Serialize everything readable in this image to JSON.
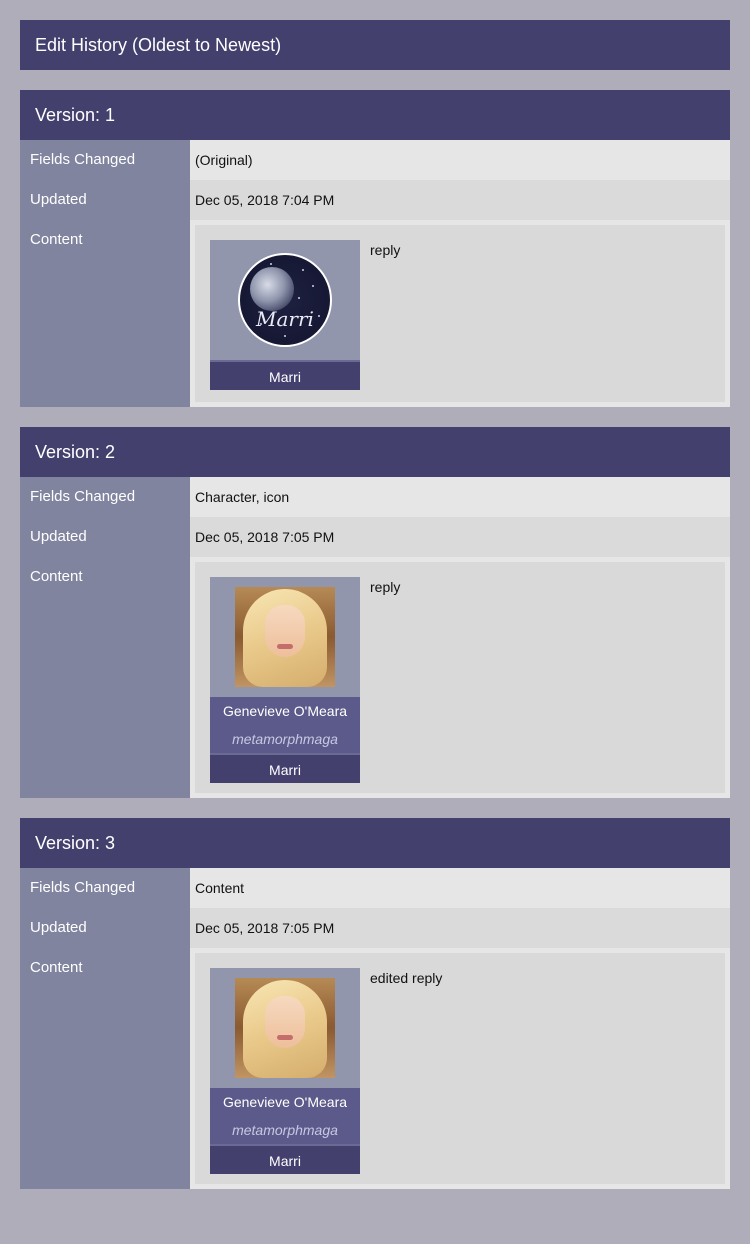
{
  "page": {
    "title": "Edit History (Oldest to Newest)"
  },
  "labels": {
    "fields_changed": "Fields Changed",
    "updated": "Updated",
    "content": "Content"
  },
  "versions": [
    {
      "header": "Version: 1",
      "fields_changed": "(Original)",
      "updated": "Dec 05, 2018 7:04 PM",
      "icon": "moon-marri-icon",
      "icon_signature": "Marri",
      "user": "Marri",
      "content": "reply"
    },
    {
      "header": "Version: 2",
      "fields_changed": "Character, icon",
      "updated": "Dec 05, 2018 7:05 PM",
      "icon": "portrait-icon",
      "character": "Genevieve O'Meara",
      "screen_name": "metamorphmaga",
      "user": "Marri",
      "content": "reply"
    },
    {
      "header": "Version: 3",
      "fields_changed": "Content",
      "updated": "Dec 05, 2018 7:05 PM",
      "icon": "portrait-icon",
      "character": "Genevieve O'Meara",
      "screen_name": "metamorphmaga",
      "user": "Marri",
      "content": "edited reply"
    }
  ],
  "colors": {
    "page_bg": "#aeadb9",
    "header_bg": "#43406e",
    "label_col": "#80849f",
    "character_bg": "#5c5a8a"
  }
}
